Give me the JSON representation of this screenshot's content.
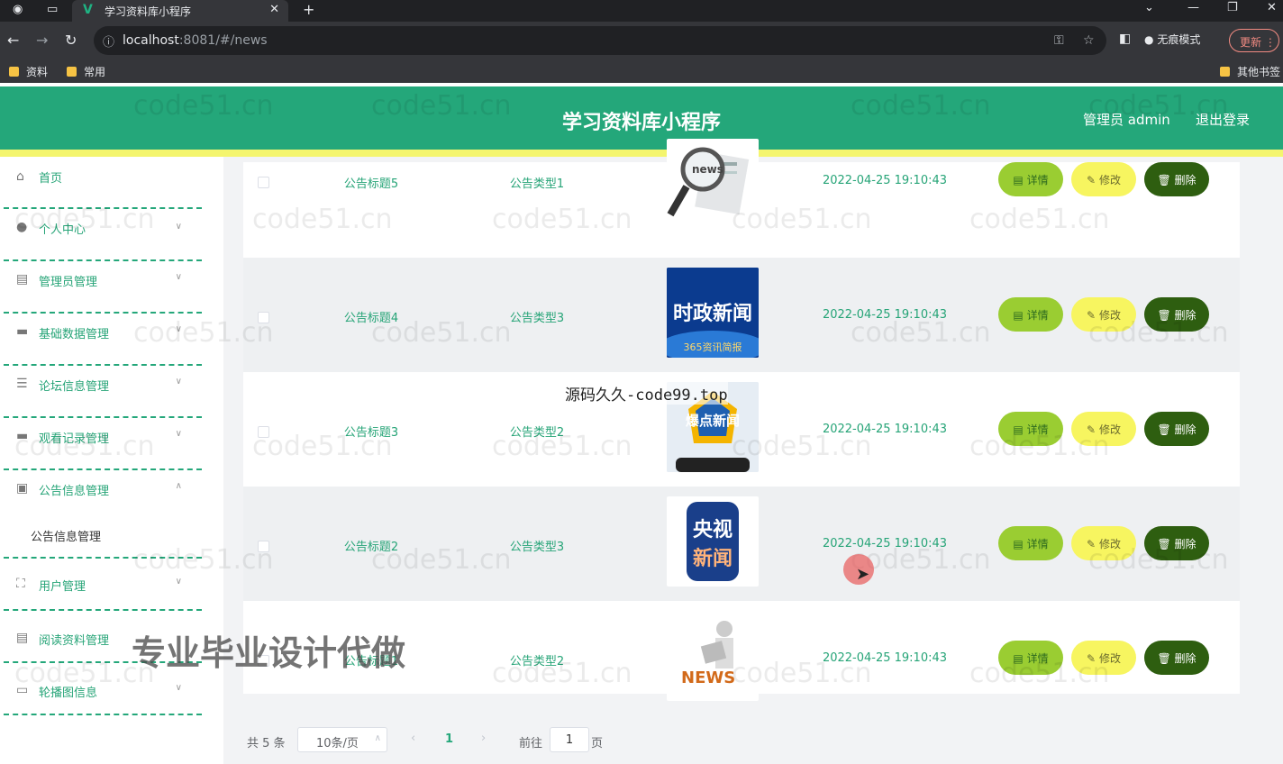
{
  "browser": {
    "tab_title": "学习资料库小程序",
    "tab_favicon": "V",
    "url_host": "localhost",
    "url_rest": ":8081/#/news",
    "incognito_label": "无痕模式",
    "update_label": "更新",
    "bookmarks": [
      "资料",
      "常用"
    ],
    "other_bookmarks": "其他书签"
  },
  "header": {
    "title": "学习资料库小程序",
    "admin_label": "管理员 admin",
    "logout_label": "退出登录"
  },
  "sidebar": {
    "items": [
      {
        "label": "首页",
        "icon": "home-icon"
      },
      {
        "label": "个人中心",
        "icon": "user-icon"
      },
      {
        "label": "管理员管理",
        "icon": "chart-icon"
      },
      {
        "label": "基础数据管理",
        "icon": "chat-icon"
      },
      {
        "label": "论坛信息管理",
        "icon": "sliders-icon"
      },
      {
        "label": "观看记录管理",
        "icon": "briefcase-icon"
      },
      {
        "label": "公告信息管理",
        "icon": "clipboard-icon"
      },
      {
        "label": "用户管理",
        "icon": "frame-icon"
      },
      {
        "label": "阅读资料管理",
        "icon": "document-icon"
      },
      {
        "label": "轮播图信息",
        "icon": "monitor-icon"
      }
    ],
    "active_submenu": "公告信息管理"
  },
  "table": {
    "rows": [
      {
        "title": "公告标题5",
        "type": "公告类型1",
        "time": "2022-04-25 19:10:43",
        "image": "news-magnifier"
      },
      {
        "title": "公告标题4",
        "type": "公告类型3",
        "time": "2022-04-25 19:10:43",
        "image": "时政新闻",
        "image_sub": "365资讯简报"
      },
      {
        "title": "公告标题3",
        "type": "公告类型2",
        "time": "2022-04-25 19:10:43",
        "image": "爆点新闻"
      },
      {
        "title": "公告标题2",
        "type": "公告类型3",
        "time": "2022-04-25 19:10:43",
        "image": "央视新闻"
      },
      {
        "title": "公告标题1",
        "type": "公告类型2",
        "time": "2022-04-25 19:10:43",
        "image": "NEWS"
      }
    ],
    "actions": {
      "detail": "详情",
      "edit": "修改",
      "delete": "删除"
    }
  },
  "pagination": {
    "total": "共 5 条",
    "page_size": "10条/页",
    "current": "1",
    "goto_label": "前往",
    "goto_value": "1",
    "page_unit": "页"
  },
  "overlays": {
    "watermark": "code51.cn",
    "source_text": "源码久久-code99.top",
    "promo_text": "专业毕业设计代做"
  },
  "colors": {
    "primary": "#24a77a",
    "stripe": "#f4f56e",
    "detail": "#9acd32",
    "edit": "#f7f560",
    "delete": "#2e5e10"
  }
}
